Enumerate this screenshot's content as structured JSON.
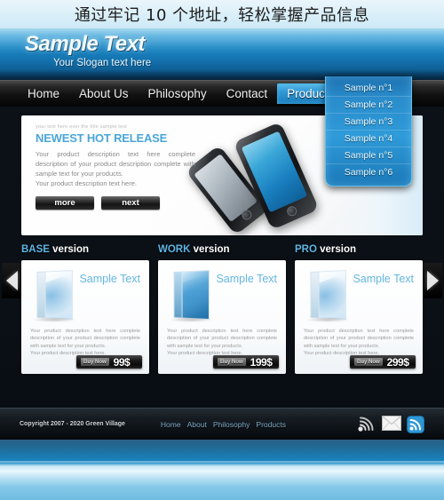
{
  "top_banner": {
    "text": "通过牢记 10 个地址，轻松掌握产品信息"
  },
  "header": {
    "logo": "Sample Text",
    "slogan": "Your Slogan text here"
  },
  "nav": {
    "items": [
      {
        "label": "Home",
        "active": false
      },
      {
        "label": "About Us",
        "active": false
      },
      {
        "label": "Philosophy",
        "active": false
      },
      {
        "label": "Contact",
        "active": false
      },
      {
        "label": "Products",
        "active": true
      }
    ],
    "star_icon": "star-icon",
    "star_glyph": "★"
  },
  "dropdown": {
    "items": [
      "Sample n°1",
      "Sample n°2",
      "Sample n°3",
      "Sample n°4",
      "Sample n°5",
      "Sample n°6"
    ]
  },
  "hero": {
    "eyebrow": "your text here over the title sample text",
    "title": "NEWEST HOT RELEASE",
    "description": "Your product description text here complete description of your product description complete with sample text for your products.",
    "description_line2": "Your product description text here.",
    "buttons": [
      {
        "label": "more"
      },
      {
        "label": "next"
      }
    ],
    "arrow_prev": "arrow-left-icon",
    "arrow_next": "arrow-right-icon"
  },
  "products": {
    "cards": [
      {
        "heading_highlight": "BASE",
        "heading_rest": " version",
        "title": "Sample Text",
        "description": "Your product description text here complete description of your product description complete with sample text for your products.",
        "description_line2": "Your product description text here.",
        "buy_label": "Buy Now",
        "price": "99$"
      },
      {
        "heading_highlight": "WORK",
        "heading_rest": " version",
        "title": "Sample Text",
        "description": "Your product description text here complete description of your product description complete with sample text for your products.",
        "description_line2": "Your product description text here.",
        "buy_label": "Buy Now",
        "price": "199$"
      },
      {
        "heading_highlight": "PRO",
        "heading_rest": " version",
        "title": "Sample Text",
        "description": "Your product description text here complete description of your product description complete with sample text for your products.",
        "description_line2": "Your product description text here.",
        "buy_label": "Buy Now",
        "price": "299$"
      }
    ]
  },
  "footer": {
    "copyright": "Copyright 2007 - 2020  Green Village",
    "links": [
      "Home",
      "About",
      "Philosophy",
      "Products"
    ],
    "icons": [
      "wifi-signal-icon",
      "envelope-icon",
      "rss-feed-icon"
    ]
  },
  "colors": {
    "accent_blue": "#2f9bd9",
    "header_blue": "#1b86c4",
    "panel_dark": "#0b1117",
    "title_blue": "#63b6e0"
  }
}
